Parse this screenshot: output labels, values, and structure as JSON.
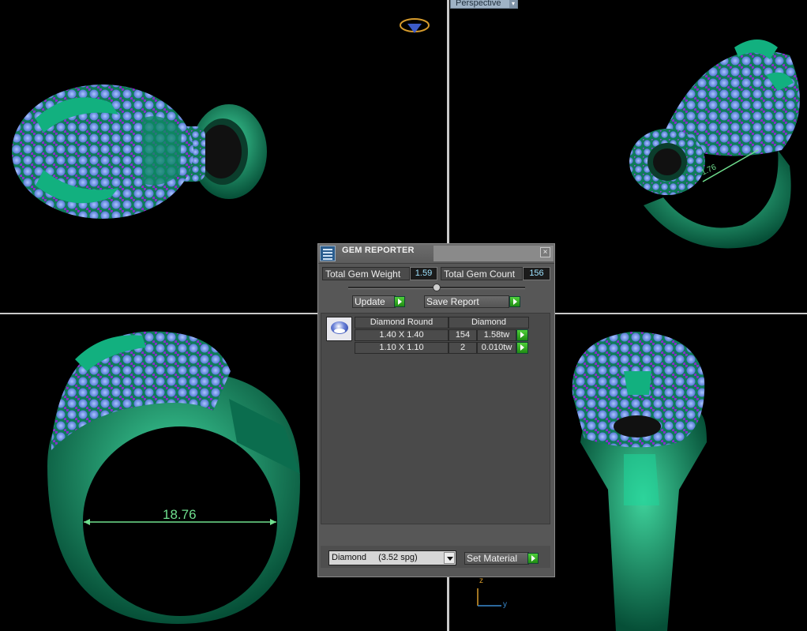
{
  "viewport": {
    "label": "Perspective",
    "dimension_front": "18.76",
    "dimension_side": "1.76",
    "axis_z": "z",
    "axis_y": "y"
  },
  "dialog": {
    "title": "GEM REPORTER",
    "close_glyph": "×",
    "total_weight_label": "Total Gem Weight",
    "total_weight_value": "1.59",
    "total_count_label": "Total Gem Count",
    "total_count_value": "156",
    "update_label": "Update",
    "save_report_label": "Save Report",
    "table": {
      "shape": "Diamond Round",
      "material": "Diamond",
      "rows": [
        {
          "size": "1.40 X 1.40",
          "count": "154",
          "weight": "1.58tw"
        },
        {
          "size": "1.10 X 1.10",
          "count": "2",
          "weight": "0.010tw"
        }
      ]
    },
    "material_select": {
      "value": "Diamond",
      "detail": "(3.52 spg)"
    },
    "set_material_label": "Set Material"
  },
  "colors": {
    "metal": "#0e8a63",
    "stone": "#7aa6e8",
    "accent_stone": "#7b2bb8",
    "dimension": "#6fdf8e"
  }
}
